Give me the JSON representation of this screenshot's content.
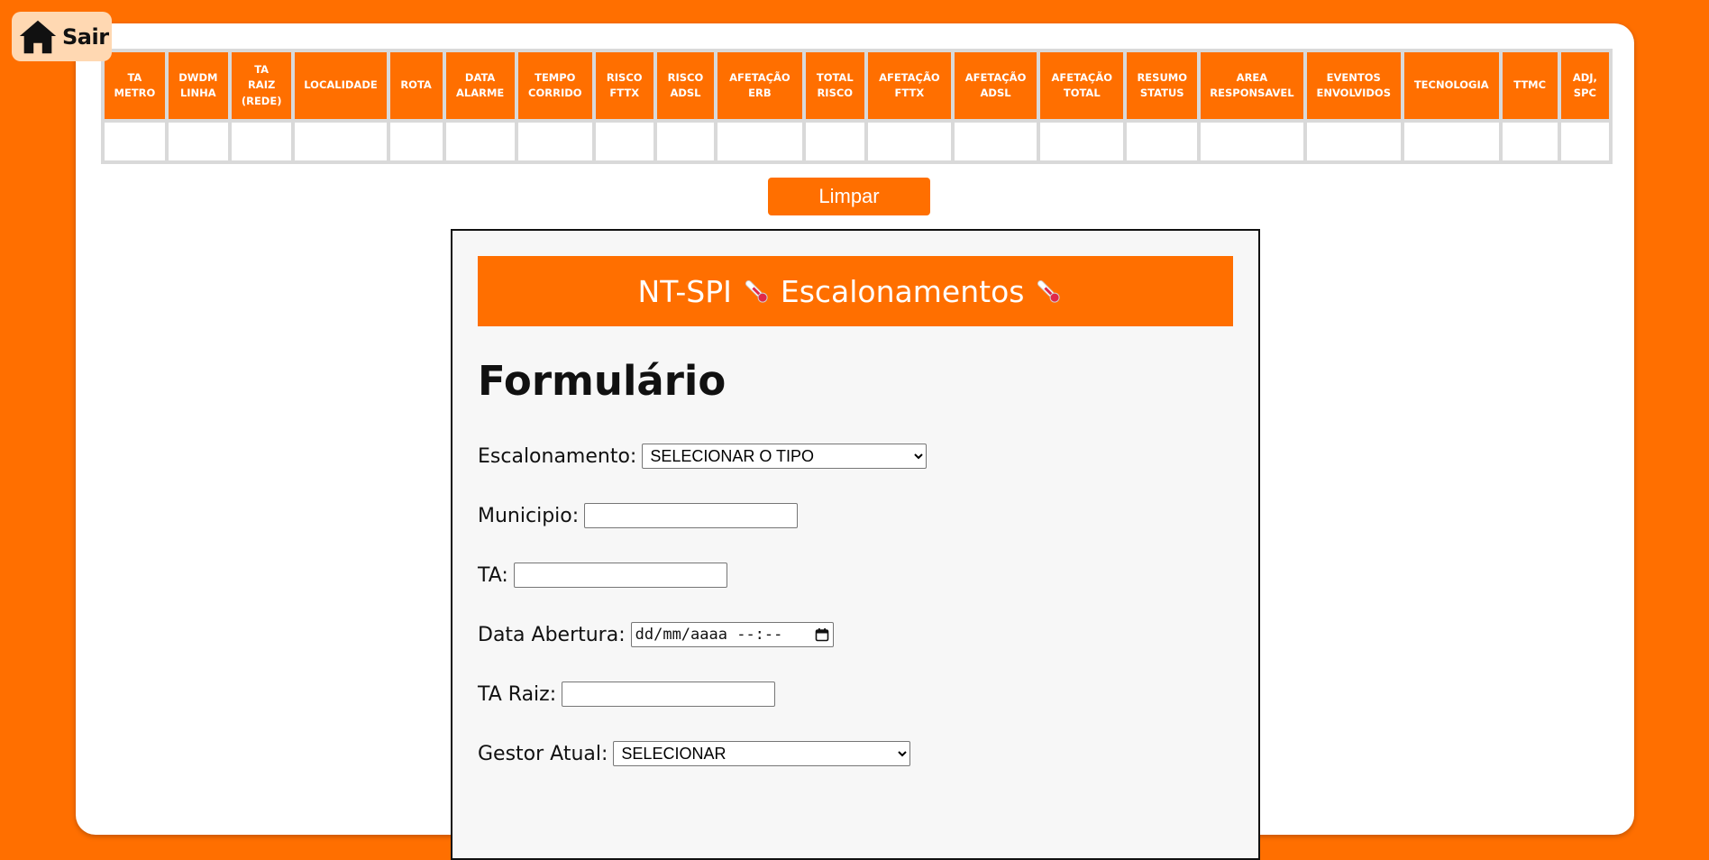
{
  "home": {
    "label": "Sair",
    "icon": "home-icon"
  },
  "table": {
    "headers": [
      [
        "TA",
        "METRO"
      ],
      [
        "DWDM",
        "LINHA"
      ],
      [
        "TA",
        "RAIZ",
        "(REDE)"
      ],
      [
        "LOCALIDADE"
      ],
      [
        "ROTA"
      ],
      [
        "DATA",
        "ALARME"
      ],
      [
        "TEMPO",
        "CORRIDO"
      ],
      [
        "RISCO",
        "FTTX"
      ],
      [
        "RISCO",
        "ADSL"
      ],
      [
        "AFETAÇÃO",
        "ERB"
      ],
      [
        "TOTAL",
        "RISCO"
      ],
      [
        "AFETAÇÃO",
        "FTTX"
      ],
      [
        "AFETAÇÃO",
        "ADSL"
      ],
      [
        "AFETAÇÃO",
        "TOTAL"
      ],
      [
        "RESUMO",
        "STATUS"
      ],
      [
        "AREA",
        "RESPONSAVEL"
      ],
      [
        "EVENTOS",
        "ENVOLVIDOS"
      ],
      [
        "TECNOLOGIA"
      ],
      [
        "TTMC"
      ],
      [
        "ADJ,",
        "SPC"
      ]
    ]
  },
  "clear_button": "Limpar",
  "form": {
    "header": {
      "left": "NT-SPI",
      "right": "Escalonamentos",
      "icon": "thermometer-icon"
    },
    "title": "Formulário",
    "fields": {
      "escalonamento": {
        "label": "Escalonamento:",
        "value": "SELECIONAR O TIPO"
      },
      "municipio": {
        "label": "Municipio:",
        "value": ""
      },
      "ta": {
        "label": "TA:",
        "value": ""
      },
      "data_abertura": {
        "label": "Data Abertura:",
        "value": "dd/mm/aaaa --:--"
      },
      "ta_raiz": {
        "label": "TA Raiz:",
        "value": ""
      },
      "gestor_atual": {
        "label": "Gestor Atual:",
        "value": "SELECIONAR"
      }
    }
  },
  "colors": {
    "accent": "#ff6f00",
    "background": "#ff6f00",
    "card": "#ffffff",
    "form_bg": "#f7f7f7"
  }
}
